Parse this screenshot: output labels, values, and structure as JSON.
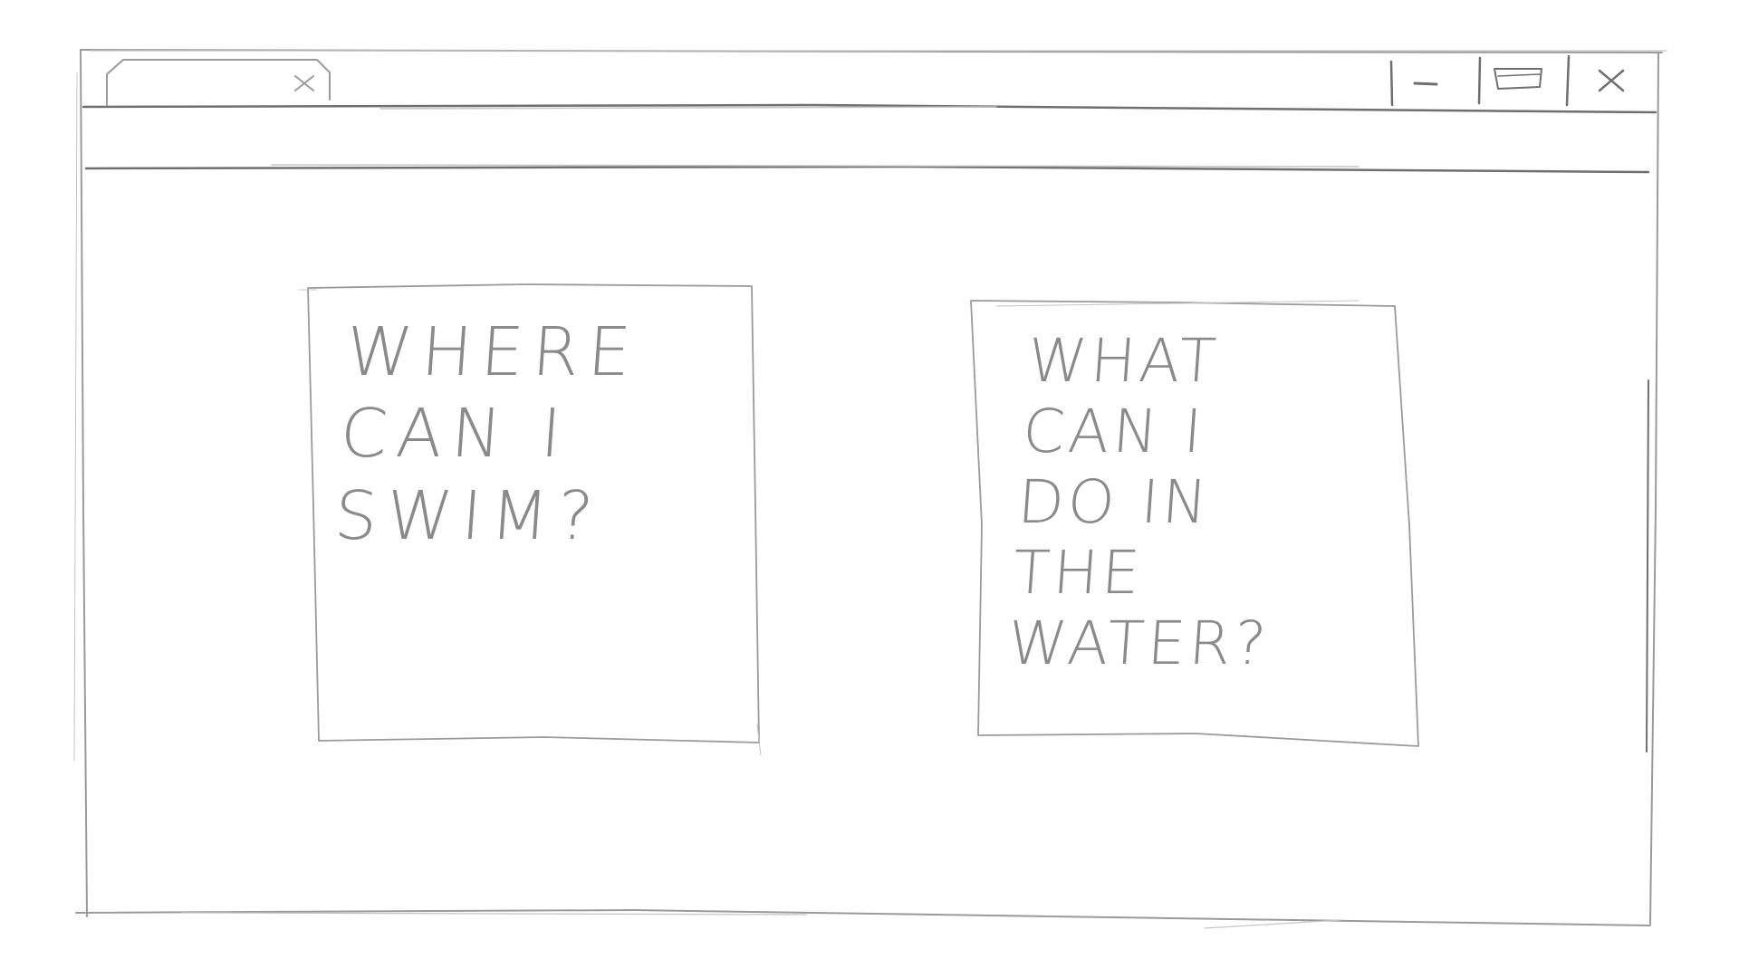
{
  "window": {
    "tab": {
      "label": ""
    },
    "controls": {
      "minimize_icon": "minimize-icon",
      "maximize_icon": "maximize-icon",
      "close_icon": "close-icon"
    }
  },
  "main": {
    "cards": [
      {
        "text": "WHERE\nCAN I\nSWIM?"
      },
      {
        "text": "WHAT\nCAN I\nDO IN\nTHE WATER?"
      }
    ]
  },
  "colors": {
    "background": "#ffffff",
    "stroke": "#9a9a9a"
  }
}
